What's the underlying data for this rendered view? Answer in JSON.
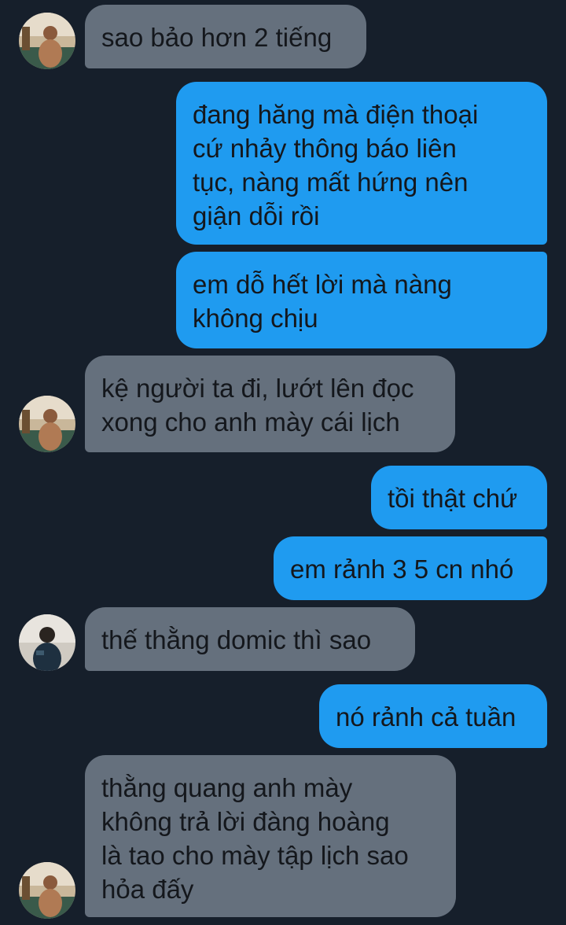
{
  "colors": {
    "background": "#161f2b",
    "incoming_bubble": "#65707d",
    "outgoing_bubble": "#1f9bf0",
    "message_text": "#14171c"
  },
  "messages": [
    {
      "direction": "incoming",
      "text": "sao bảo hơn 2 tiếng"
    },
    {
      "direction": "outgoing",
      "text": "đang hăng mà điện thoại\ncứ nhảy thông báo liên\ntục, nàng mất hứng nên\ngiận dỗi rồi"
    },
    {
      "direction": "outgoing",
      "text": "em dỗ hết lời mà nàng\nkhông chịu"
    },
    {
      "direction": "incoming",
      "text": "kệ người ta đi, lướt lên đọc\nxong cho anh mày cái lịch"
    },
    {
      "direction": "outgoing",
      "text": "tồi thật chứ"
    },
    {
      "direction": "outgoing",
      "text": "em rảnh 3 5 cn nhó"
    },
    {
      "direction": "incoming",
      "text": "thế thằng domic thì sao"
    },
    {
      "direction": "outgoing",
      "text": "nó rảnh cả tuần"
    },
    {
      "direction": "incoming",
      "text": "thằng quang anh mày\nkhông trả lời đàng hoàng\nlà tao cho mày tập lịch sao\nhỏa đấy"
    }
  ]
}
